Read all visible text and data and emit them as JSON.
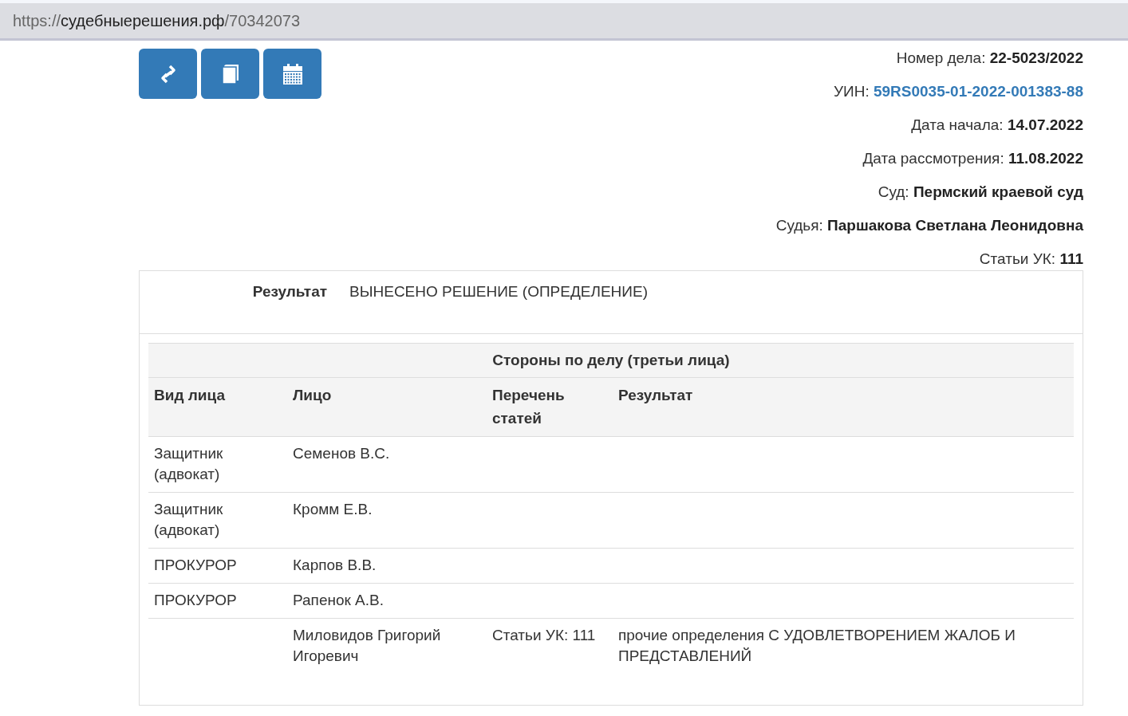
{
  "address_bar": {
    "scheme": "https://",
    "host": "судебныерешения.рф",
    "path": "/70342073"
  },
  "toolbar": [
    {
      "kind": "link"
    },
    {
      "kind": "book"
    },
    {
      "kind": "calendar"
    }
  ],
  "case_info": [
    {
      "label": "Номер дела:",
      "value": "22-5023/2022",
      "kind": "bold"
    },
    {
      "label": "УИН:",
      "value": "59RS0035-01-2022-001383-88",
      "kind": "link"
    },
    {
      "label": "Дата начала:",
      "value": "14.07.2022",
      "kind": "bold"
    },
    {
      "label": "Дата рассмотрения:",
      "value": "11.08.2022",
      "kind": "bold"
    },
    {
      "label": "Суд:",
      "value": "Пермский краевой суд",
      "kind": "bold"
    },
    {
      "label": "Судья:",
      "value": "Паршакова Светлана Леонидовна",
      "kind": "bold"
    },
    {
      "label": "Статьи УК:",
      "value": "111",
      "kind": "bold"
    }
  ],
  "result": {
    "label": "Результат",
    "value": "ВЫНЕСЕНО РЕШЕНИЕ (ОПРЕДЕЛЕНИЕ)"
  },
  "parties": {
    "title": "Стороны по делу (третьи лица)",
    "columns": [
      "Вид лица",
      "Лицо",
      "Перечень статей",
      "Результат"
    ],
    "rows": [
      [
        "Защитник (адвокат)",
        "Семенов В.С.",
        "",
        ""
      ],
      [
        "Защитник (адвокат)",
        "Кромм Е.В.",
        "",
        ""
      ],
      [
        "ПРОКУРОР",
        "Карпов В.В.",
        "",
        ""
      ],
      [
        "ПРОКУРОР",
        "Рапенок А.В.",
        "",
        ""
      ],
      [
        "",
        "Миловидов Григорий Игоревич",
        "Статьи УК: 111",
        "прочие определения С УДОВЛЕТВОРЕНИЕМ ЖАЛОБ И ПРЕДСТАВЛЕНИЙ"
      ]
    ]
  }
}
